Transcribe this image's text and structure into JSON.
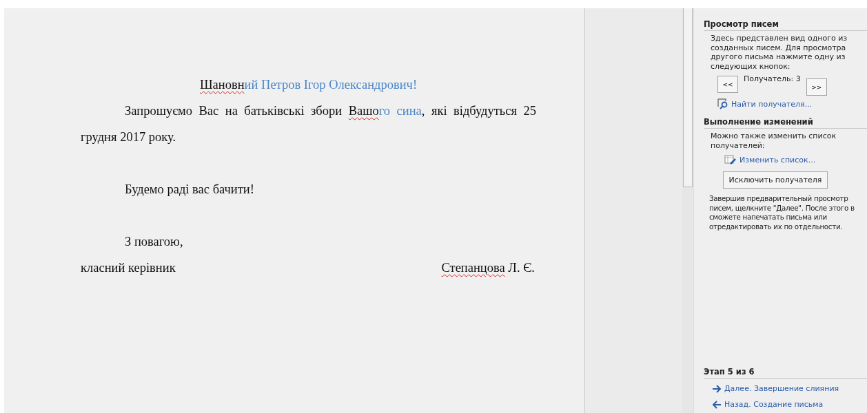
{
  "document": {
    "paragraphs": [
      {
        "kind": "centered",
        "segments": [
          {
            "text": "Шановн",
            "merged": false,
            "misspelled": true
          },
          {
            "text": "ий  Петров Ігор Олександрович!",
            "merged": true,
            "misspelled": false
          }
        ]
      },
      {
        "kind": "indented",
        "segments": [
          {
            "text": "Запрошуємо Вас на батьківські збори ",
            "merged": false,
            "misspelled": false
          },
          {
            "text": "Вашо",
            "merged": false,
            "misspelled": true
          },
          {
            "text": "го сина",
            "merged": true,
            "misspelled": false
          },
          {
            "text": ",  які відбудуться 25 грудня 2017 року.",
            "merged": false,
            "misspelled": false
          }
        ]
      },
      {
        "kind": "blank"
      },
      {
        "kind": "indented",
        "segments": [
          {
            "text": "Будемо раді вас бачити!",
            "merged": false,
            "misspelled": false
          }
        ]
      },
      {
        "kind": "blank"
      },
      {
        "kind": "indented",
        "segments": [
          {
            "text": "З повагою,",
            "merged": false,
            "misspelled": false
          }
        ]
      }
    ],
    "signature": {
      "role": "класний керівник",
      "name_segments": [
        {
          "text": "Степанцова",
          "merged": false,
          "misspelled": true
        },
        {
          "text": " Л. Є.",
          "merged": false,
          "misspelled": false
        }
      ]
    }
  },
  "pane": {
    "preview_section": {
      "title": "Просмотр писем",
      "description": "Здесь представлен вид одного из созданных писем. Для просмотра другого письма нажмите одну из следующих кнопок:",
      "prev_button": "<<",
      "recipient_label": "Получатель: 3",
      "next_button": ">>",
      "find_link": "Найти получателя..."
    },
    "changes_section": {
      "title": "Выполнение изменений",
      "description": "Можно также изменить список получателей:",
      "edit_link": "Изменить список...",
      "exclude_button": "Исключить получателя",
      "note": "Завершив предварительный просмотр писем, щелкните \"Далее\". После этого в",
      "note_rest": "сможете напечатать письма или отредактировать их по отдельности."
    },
    "step": {
      "title": "Этап 5 из 6",
      "next_link": "Далее. Завершение слияния",
      "back_link": "Назад. Создание письма"
    }
  }
}
